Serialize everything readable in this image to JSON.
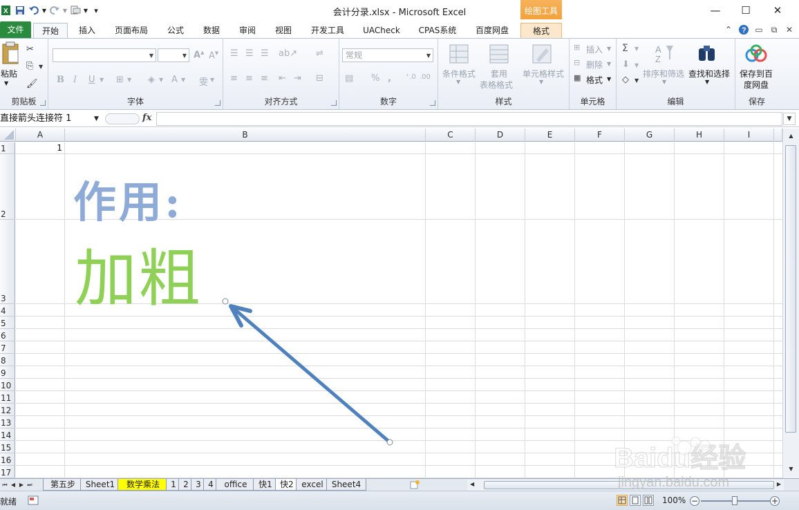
{
  "window": {
    "title": "会计分录.xlsx - Microsoft Excel",
    "contextual_tab_header": "绘图工具"
  },
  "tabs": {
    "file": "文件",
    "home": "开始",
    "insert": "插入",
    "page_layout": "页面布局",
    "formulas": "公式",
    "data": "数据",
    "review": "审阅",
    "view": "视图",
    "developer": "开发工具",
    "uacheck": "UACheck",
    "cpas": "CPAS系统",
    "baidu": "百度网盘",
    "format": "格式"
  },
  "ribbon": {
    "clipboard": {
      "label": "剪贴板",
      "paste": "粘贴"
    },
    "font": {
      "label": "字体",
      "font_name": "",
      "font_size": ""
    },
    "alignment": {
      "label": "对齐方式"
    },
    "number": {
      "label": "数字",
      "format_combo": "常规"
    },
    "styles": {
      "label": "样式",
      "conditional": "条件格式",
      "table_1": "套用",
      "table_2": "表格格式",
      "cell_styles": "单元格样式"
    },
    "cells": {
      "label": "单元格",
      "insert": "插入",
      "delete": "删除",
      "format": "格式"
    },
    "editing": {
      "label": "编辑",
      "sort_filter": "排序和筛选",
      "find_select": "查找和选择"
    },
    "save": {
      "label": "保存",
      "save_to_1": "保存到百",
      "save_to_2": "度网盘"
    }
  },
  "formula_bar": {
    "name_box": "直接箭头连接符 1",
    "fx": "fx",
    "formula": ""
  },
  "grid": {
    "columns": [
      "A",
      "B",
      "C",
      "D",
      "E",
      "F",
      "G",
      "H",
      "I"
    ],
    "rows": [
      "1",
      "2",
      "3",
      "4",
      "5",
      "6",
      "7",
      "8",
      "9",
      "10",
      "11",
      "12",
      "13",
      "14",
      "15",
      "16",
      "17"
    ],
    "cell_a1": "1",
    "text_b2": "作用:",
    "text_b3": "加粗",
    "colors": {
      "b2_text": "#8eaad6",
      "b3_text": "#8fd156",
      "arrow": "#4f81bd"
    }
  },
  "sheet_tabs": [
    "第五步",
    "Sheet1",
    "数学乘法",
    "1",
    "2",
    "3",
    "4",
    "office",
    "快1",
    "快2",
    "excel",
    "Sheet4"
  ],
  "active_sheet": "快2",
  "status_bar": {
    "status": "就绪",
    "zoom": "100%"
  },
  "watermark": {
    "text": "Baidu经验",
    "url": "jingyan.baidu.com"
  }
}
